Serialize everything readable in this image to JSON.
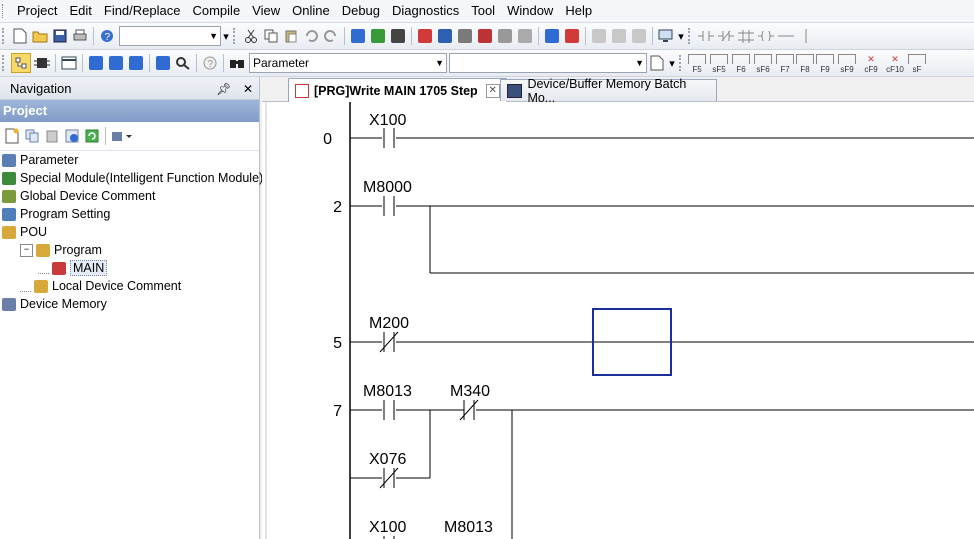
{
  "menubar": {
    "items": [
      {
        "label": "Project",
        "u": "P"
      },
      {
        "label": "Edit",
        "u": "E"
      },
      {
        "label": "Find/Replace",
        "u": "F"
      },
      {
        "label": "Compile",
        "u": "C"
      },
      {
        "label": "View",
        "u": "V"
      },
      {
        "label": "Online",
        "u": "O"
      },
      {
        "label": "Debug",
        "u": "D"
      },
      {
        "label": "Diagnostics",
        "u": "D"
      },
      {
        "label": "Tool",
        "u": "T"
      },
      {
        "label": "Window",
        "u": "W"
      },
      {
        "label": "Help",
        "u": "H"
      }
    ]
  },
  "toolbar2": {
    "combo_left_value": "",
    "combo_parameter_value": "Parameter",
    "combo_right_value": "",
    "fkeys": [
      "F5",
      "sF5",
      "F6",
      "sF6",
      "F7",
      "F8",
      "F9",
      "sF9",
      "cF9",
      "cF10",
      "sF"
    ]
  },
  "navigation": {
    "title": "Navigation",
    "pin": "ᵖ",
    "close": "✕",
    "project_label": "Project",
    "tree": [
      {
        "label": "Parameter",
        "level": 0,
        "color": "#5b7fb3"
      },
      {
        "label": "Special Module(Intelligent Function Module)",
        "level": 0,
        "color": "#3c8a3c"
      },
      {
        "label": "Global Device Comment",
        "level": 0,
        "color": "#7b9a3b"
      },
      {
        "label": "Program Setting",
        "level": 0,
        "color": "#4f7fb8"
      },
      {
        "label": "POU",
        "level": 0,
        "color": "#d7a93a"
      },
      {
        "label": "Program",
        "level": 1,
        "color": "#d7a93a"
      },
      {
        "label": "MAIN",
        "level": 2,
        "color": "#c83a3a",
        "selected": true
      },
      {
        "label": "Local Device Comment",
        "level": 1,
        "color": "#d7a93a"
      },
      {
        "label": "Device Memory",
        "level": 0,
        "color": "#6a7fa8"
      }
    ]
  },
  "tabs": [
    {
      "label": "[PRG]Write MAIN 1705 Step",
      "active": true,
      "close": "✕"
    },
    {
      "label": "Device/Buffer Memory Batch Mo...",
      "active": false
    }
  ],
  "ladder": {
    "steps": [
      "0",
      "2",
      "5",
      "7"
    ],
    "devices": {
      "x100": "X100",
      "m8000": "M8000",
      "m200": "M200",
      "m8013": "M8013",
      "m340": "M340",
      "x076": "X076",
      "x100b": "X100",
      "m8013b": "M8013"
    },
    "colors": {
      "rail": "#000000",
      "cursor": "#1a2e9c"
    }
  }
}
